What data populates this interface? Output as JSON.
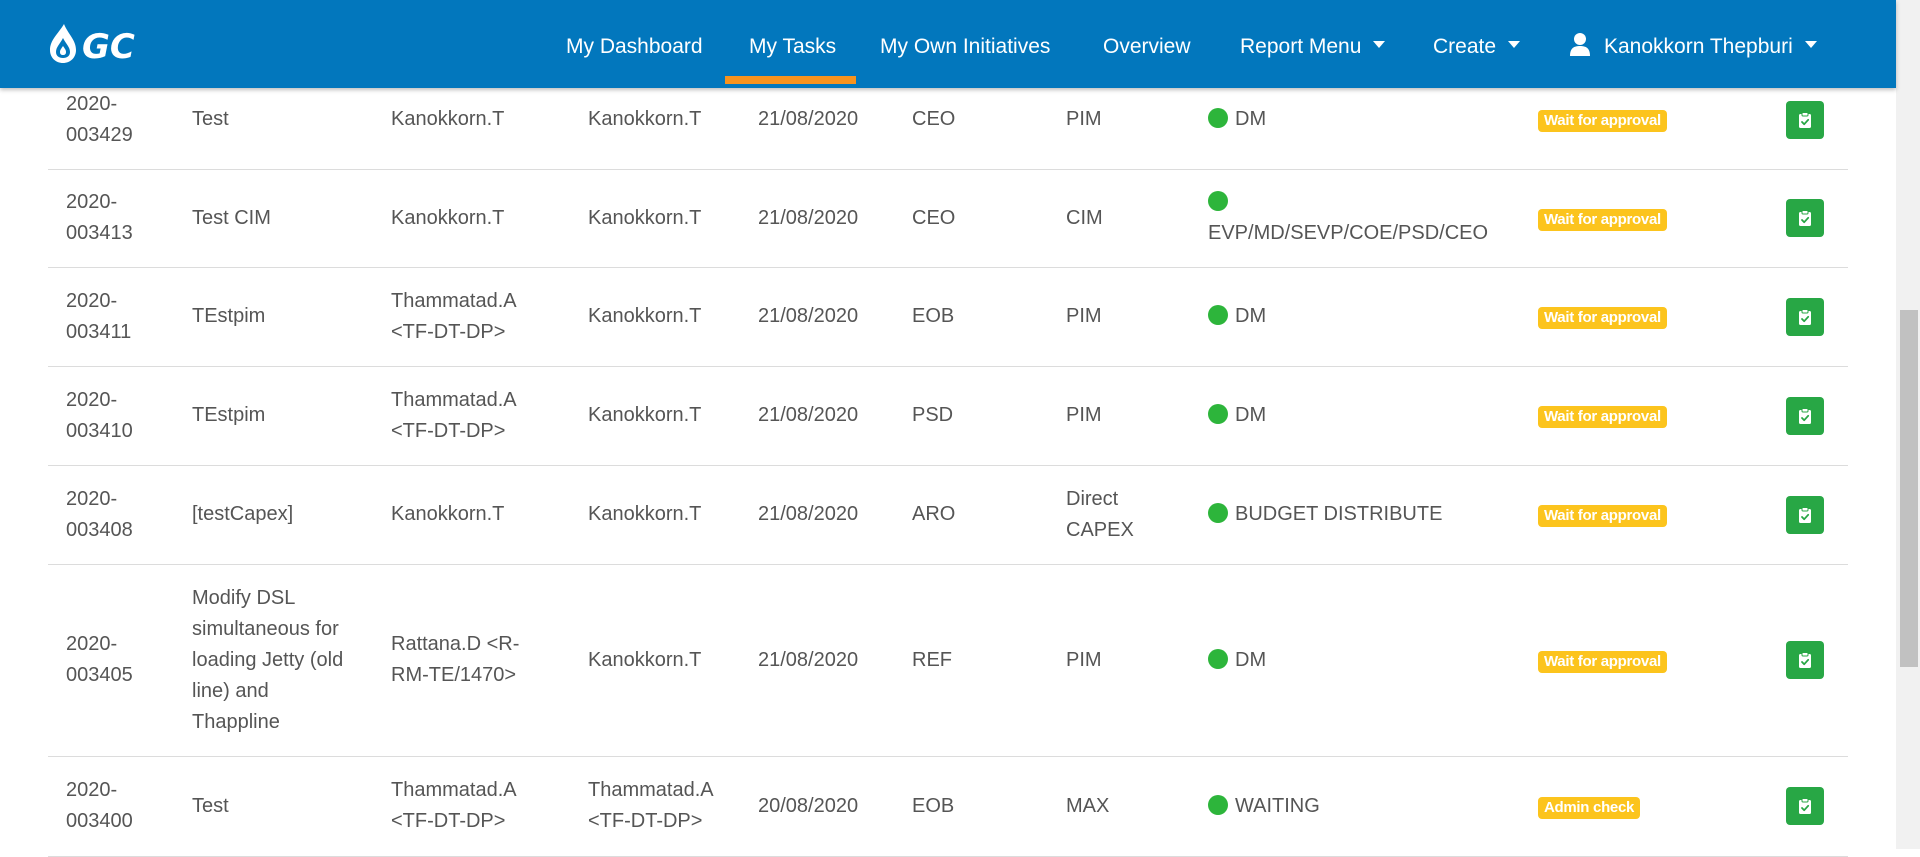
{
  "nav": {
    "items": [
      {
        "label": "My Dashboard"
      },
      {
        "label": "My Tasks"
      },
      {
        "label": "My Own Initiatives"
      },
      {
        "label": "Overview"
      },
      {
        "label": "Report Menu"
      },
      {
        "label": "Create"
      }
    ],
    "user_name": "Kanokkorn Thepburi",
    "active_item": "My Tasks"
  },
  "colors": {
    "navbar": "#0277bd",
    "active_underline": "#f7931e",
    "status_dot": "#2db53b",
    "badge": "#fcc41d",
    "action_button": "#28a745"
  },
  "rows": [
    {
      "id": [
        "2020-",
        "003429"
      ],
      "name": [
        "Test"
      ],
      "owner": [
        "Kanokkorn.T"
      ],
      "creator": [
        "Kanokkorn.T"
      ],
      "date": "21/08/2020",
      "org": "CEO",
      "type": [
        "PIM"
      ],
      "stage": "DM",
      "status": "Wait for approval"
    },
    {
      "id": [
        "2020-",
        "003413"
      ],
      "name": [
        "Test CIM"
      ],
      "owner": [
        "Kanokkorn.T"
      ],
      "creator": [
        "Kanokkorn.T"
      ],
      "date": "21/08/2020",
      "org": "CEO",
      "type": [
        "CIM"
      ],
      "stage": "EVP/MD/SEVP/COE/PSD/CEO",
      "status": "Wait for approval"
    },
    {
      "id": [
        "2020-",
        "003411"
      ],
      "name": [
        "TEstpim"
      ],
      "owner": [
        "Thammatad.A",
        "<TF-DT-DP>"
      ],
      "creator": [
        "Kanokkorn.T"
      ],
      "date": "21/08/2020",
      "org": "EOB",
      "type": [
        "PIM"
      ],
      "stage": "DM",
      "status": "Wait for approval"
    },
    {
      "id": [
        "2020-",
        "003410"
      ],
      "name": [
        "TEstpim"
      ],
      "owner": [
        "Thammatad.A",
        "<TF-DT-DP>"
      ],
      "creator": [
        "Kanokkorn.T"
      ],
      "date": "21/08/2020",
      "org": "PSD",
      "type": [
        "PIM"
      ],
      "stage": "DM",
      "status": "Wait for approval"
    },
    {
      "id": [
        "2020-",
        "003408"
      ],
      "name": [
        "[testCapex]"
      ],
      "owner": [
        "Kanokkorn.T"
      ],
      "creator": [
        "Kanokkorn.T"
      ],
      "date": "21/08/2020",
      "org": "ARO",
      "type": [
        "Direct",
        "CAPEX"
      ],
      "stage": "BUDGET DISTRIBUTE",
      "status": "Wait for approval"
    },
    {
      "id": [
        "2020-",
        "003405"
      ],
      "name": [
        "Modify DSL",
        "simultaneous for",
        "loading Jetty (old",
        "line) and",
        "Thappline"
      ],
      "owner": [
        "Rattana.D <R-",
        "RM-TE/1470>"
      ],
      "creator": [
        "Kanokkorn.T"
      ],
      "date": "21/08/2020",
      "org": "REF",
      "type": [
        "PIM"
      ],
      "stage": "DM",
      "status": "Wait for approval"
    },
    {
      "id": [
        "2020-",
        "003400"
      ],
      "name": [
        "Test"
      ],
      "owner": [
        "Thammatad.A",
        "<TF-DT-DP>"
      ],
      "creator": [
        "Thammatad.A",
        "<TF-DT-DP>"
      ],
      "date": "20/08/2020",
      "org": "EOB",
      "type": [
        "MAX"
      ],
      "stage": "WAITING",
      "status": "Admin check"
    }
  ]
}
